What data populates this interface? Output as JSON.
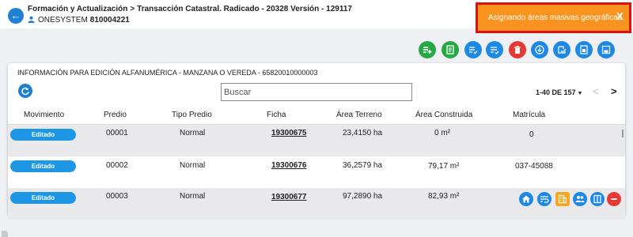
{
  "header": {
    "breadcrumb_root": "Formación y Actualización",
    "breadcrumb_separator": ">",
    "breadcrumb_current": "Transacción Catastral. Radicado - 20328 Versión - 129117",
    "user_name": "ONESYSTEM",
    "user_code": "810004221"
  },
  "notification": {
    "message": "Asignando áreas masivas geográficas",
    "close_label": "X"
  },
  "toolbar": {
    "buttons": [
      {
        "icon": "add-list-icon",
        "color": "#28a745"
      },
      {
        "icon": "document-icon",
        "color": "#28a745"
      },
      {
        "icon": "list-check-icon",
        "color": "#1e88e5"
      },
      {
        "icon": "list-check-alt-icon",
        "color": "#1e88e5"
      },
      {
        "icon": "delete-icon",
        "color": "#e53935"
      },
      {
        "icon": "download-icon",
        "color": "#1e88e5"
      },
      {
        "icon": "export-icon",
        "color": "#1e88e5"
      },
      {
        "icon": "report-icon",
        "color": "#1e88e5"
      },
      {
        "icon": "save-icon",
        "color": "#1e88e5"
      }
    ]
  },
  "section": {
    "title": "INFORMACIÓN PARA EDICIÓN ALFANUMÉRICA - MANZANA O VEREDA - 65820010000003"
  },
  "search": {
    "placeholder": "Buscar",
    "value": ""
  },
  "pagination": {
    "range_label": "1-40 DE 157",
    "prev_symbol": "<",
    "next_symbol": ">"
  },
  "table": {
    "columns": [
      "Movimiento",
      "Predio",
      "Tipo Predio",
      "Ficha",
      "Área Terreno",
      "Área Construida",
      "Matrícula"
    ],
    "rows": [
      {
        "movimiento": "Editado",
        "predio": "00001",
        "tipo": "Normal",
        "ficha": "19300675",
        "area_terreno": "23,4150 ha",
        "area_construida": "0 m²",
        "matricula": "0"
      },
      {
        "movimiento": "Editado",
        "predio": "00002",
        "tipo": "Normal",
        "ficha": "19300676",
        "area_terreno": "36,2579 ha",
        "area_construida": "79,17 m²",
        "matricula": "037-45088"
      },
      {
        "movimiento": "Editado",
        "predio": "00003",
        "tipo": "Normal",
        "ficha": "19300677",
        "area_terreno": "97,2890 ha",
        "area_construida": "82,93 m²",
        "matricula": ""
      }
    ]
  },
  "floating_actions": [
    {
      "icon": "home-icon",
      "color": "#1e88e5"
    },
    {
      "icon": "wrap-text-icon",
      "color": "#1e88e5"
    },
    {
      "icon": "building-icon",
      "color": "#f5a623"
    },
    {
      "icon": "people-icon",
      "color": "#1e88e5"
    },
    {
      "icon": "book-icon",
      "color": "#1e88e5"
    },
    {
      "icon": "minus-icon",
      "color": "#e53935"
    }
  ],
  "colors": {
    "accent": "#1e88e5",
    "notification": "#f7931e",
    "notification_border": "#e01010",
    "pill": "#1e96e6"
  }
}
